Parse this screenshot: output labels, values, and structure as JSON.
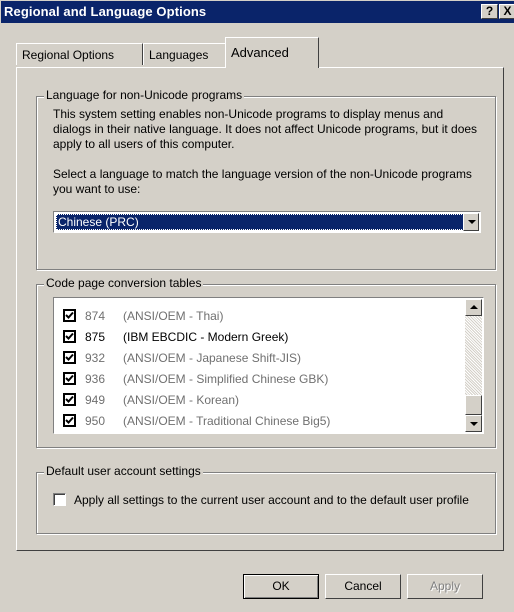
{
  "window": {
    "title": "Regional and Language Options",
    "help_button": "?",
    "close_button": "X"
  },
  "tabs": [
    {
      "label": "Regional Options",
      "active": false
    },
    {
      "label": "Languages",
      "active": false
    },
    {
      "label": "Advanced",
      "active": true
    }
  ],
  "non_unicode": {
    "group_title": "Language for non-Unicode programs",
    "description": "This system setting enables non-Unicode programs to display menus and dialogs in their native language. It does not affect Unicode programs, but it does apply to all users of this computer.",
    "select_label": "Select a language to match the language version of the non-Unicode programs you want to use:",
    "selected_language": "Chinese (PRC)"
  },
  "code_pages": {
    "group_title": "Code page conversion tables",
    "items": [
      {
        "code": "874",
        "name": "(ANSI/OEM - Thai)",
        "checked": true,
        "enabled": false
      },
      {
        "code": "875",
        "name": "(IBM EBCDIC - Modern Greek)",
        "checked": true,
        "enabled": true
      },
      {
        "code": "932",
        "name": "(ANSI/OEM - Japanese Shift-JIS)",
        "checked": true,
        "enabled": false
      },
      {
        "code": "936",
        "name": "(ANSI/OEM - Simplified Chinese GBK)",
        "checked": true,
        "enabled": false
      },
      {
        "code": "949",
        "name": "(ANSI/OEM - Korean)",
        "checked": true,
        "enabled": false
      },
      {
        "code": "950",
        "name": "(ANSI/OEM - Traditional Chinese Big5)",
        "checked": true,
        "enabled": false
      }
    ]
  },
  "default_user": {
    "group_title": "Default user account settings",
    "checkbox_label": "Apply all settings to the current user account and to the default user profile",
    "checked": false
  },
  "buttons": {
    "ok": "OK",
    "cancel": "Cancel",
    "apply": "Apply"
  },
  "colors": {
    "titlebar": "#0a246a",
    "face": "#d4d0c8",
    "selection": "#0a246a"
  }
}
